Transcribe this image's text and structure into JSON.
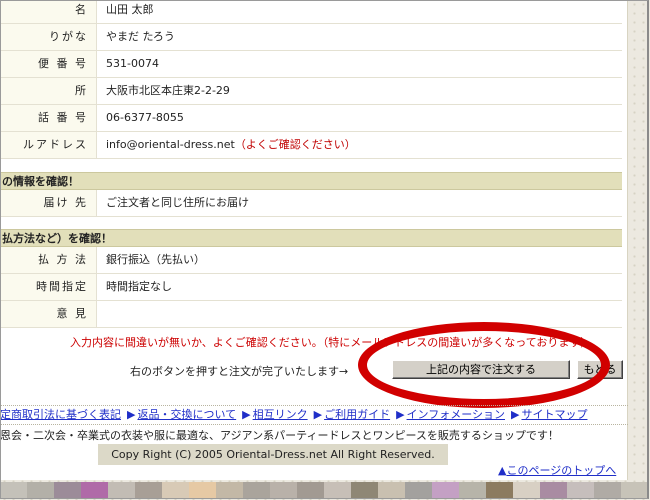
{
  "customer_rows": [
    {
      "label": "名",
      "value": "山田 太郎"
    },
    {
      "label": "りがな",
      "value": "やまだ たろう"
    },
    {
      "label": "便 番 号",
      "value": "531-0074"
    },
    {
      "label": "所",
      "value": "大阪市北区本庄東2-2-29"
    },
    {
      "label": "話 番 号",
      "value": "06-6377-8055"
    },
    {
      "label": "ルアドレス",
      "value": "info@oriental-dress.net",
      "note": "（よくご確認ください）"
    }
  ],
  "delivery": {
    "heading": "の情報を確認！",
    "rows": [
      {
        "label": "届け 先",
        "value": "ご注文者と同じ住所にお届け"
      }
    ]
  },
  "payment": {
    "heading": "払方法など）を確認！",
    "rows": [
      {
        "label": "払 方 法",
        "value": "銀行振込（先払い）"
      },
      {
        "label": "時間指定",
        "value": "時間指定なし"
      },
      {
        "label": "意 見",
        "value": ""
      }
    ]
  },
  "warning": "入力内容に間違いが無いか、よくご確認ください。（特にメールアドレスの間違いが多くなっております）",
  "instruction": "右のボタンを押すと注文が完了いたします→",
  "buttons": {
    "order": "上記の内容で注文する",
    "back": "もどる"
  },
  "footer_links": [
    {
      "label": "定商取引法に基づく表記",
      "leading_arrow": false
    },
    {
      "label": "返品・交換について",
      "leading_arrow": true
    },
    {
      "label": "相互リンク",
      "leading_arrow": true
    },
    {
      "label": "ご利用ガイド",
      "leading_arrow": true
    },
    {
      "label": "インフォメーション",
      "leading_arrow": true
    },
    {
      "label": "サイトマップ",
      "leading_arrow": true
    }
  ],
  "link_arrow": "▶",
  "tagline": "恩会・二次会・卒業式の衣装や服に最適な、アジアン系パーティードレスとワンピースを販売するショップです！",
  "copyright": "Copy Right (C) 2005 Oriental-Dress.net All Right Reserved.",
  "page_top": {
    "arrow": "▲",
    "label": "このページのトップへ"
  },
  "colors": {
    "accent_red": "#d10000",
    "link_blue": "#1f2ec8",
    "section_header_bg": "#e2dfba",
    "label_cell_bg": "#fbfaee",
    "swatches": [
      "#c4c1b9",
      "#b3b0a8",
      "#9c8c99",
      "#b06aa8",
      "#c2bcb4",
      "#a89f96",
      "#d8cab6",
      "#e6c9a4",
      "#c3b8a6",
      "#aaa49c",
      "#b9b1a9",
      "#a29a92",
      "#c7bfb7",
      "#8f8775",
      "#c9c0b0",
      "#a3a19e",
      "#c4a0c4",
      "#b7b4a9",
      "#8c7b60",
      "#d8d0c4",
      "#a98ca2",
      "#c6bebc",
      "#b0aba5",
      "#c7c3b8"
    ]
  }
}
